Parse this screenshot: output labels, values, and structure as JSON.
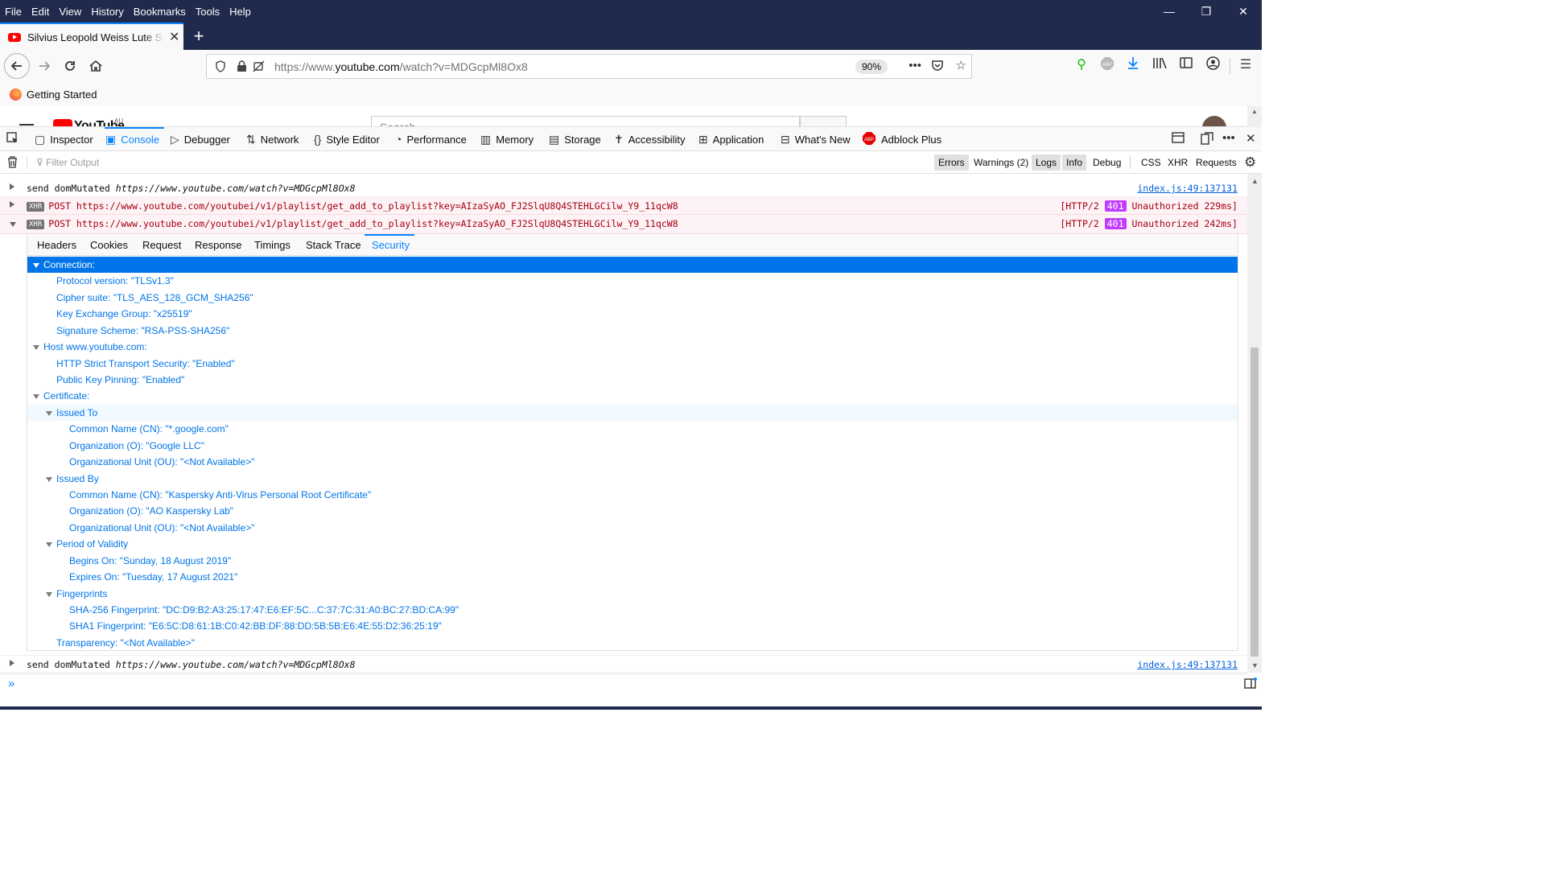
{
  "menu": [
    "File",
    "Edit",
    "View",
    "History",
    "Bookmarks",
    "Tools",
    "Help"
  ],
  "window_controls": {
    "minimize": "—",
    "restore": "❐",
    "close": "✕"
  },
  "tab": {
    "title": "Silvius Leopold Weiss Lute Son",
    "close": "✕"
  },
  "newtab_label": "+",
  "nav": {
    "url_prefix": "https://www.",
    "url_domain": "youtube.com",
    "url_rest": "/watch?v=MDGcpMl8Ox8",
    "zoom": "90%"
  },
  "bookmarks": {
    "item": "Getting Started"
  },
  "page": {
    "brand": "YouTube",
    "region": "AU",
    "search_placeholder": "Search"
  },
  "devtools": {
    "tabs": [
      "Inspector",
      "Console",
      "Debugger",
      "Network",
      "Style Editor",
      "Performance",
      "Memory",
      "Storage",
      "Accessibility",
      "Application",
      "What's New",
      "Adblock Plus"
    ],
    "filter_placeholder": "Filter Output",
    "filters": [
      "Errors",
      "Warnings (2)",
      "Logs",
      "Info",
      "Debug",
      "CSS",
      "XHR",
      "Requests"
    ]
  },
  "console": {
    "msg1": {
      "text_plain": "send domMutated ",
      "text_url": "https://www.youtube.com/watch?v=MDGcpMl8Ox8",
      "source": "index.js:49:137131"
    },
    "xhr1": {
      "badge": "XHR",
      "method": "POST",
      "url": "https://www.youtube.com/youtubei/v1/playlist/get_add_to_playlist?key=AIzaSyAO_FJ2SlqU8Q4STEHLGCilw_Y9_11qcW8",
      "status_pre": "[HTTP/2",
      "code": "401",
      "status_post": "Unauthorized 229ms]"
    },
    "xhr2": {
      "badge": "XHR",
      "method": "POST",
      "url": "https://www.youtube.com/youtubei/v1/playlist/get_add_to_playlist?key=AIzaSyAO_FJ2SlqU8Q4STEHLGCilw_Y9_11qcW8",
      "status_pre": "[HTTP/2",
      "code": "401",
      "status_post": "Unauthorized 242ms]"
    },
    "msg2": {
      "text_plain": "send domMutated ",
      "text_url": "https://www.youtube.com/watch?v=MDGcpMl8Ox8",
      "source": "index.js:49:137131"
    }
  },
  "detail_tabs": [
    "Headers",
    "Cookies",
    "Request",
    "Response",
    "Timings",
    "Stack Trace",
    "Security"
  ],
  "security": {
    "connection": "Connection:",
    "protocol": "Protocol version: \"TLSv1.3\"",
    "cipher": "Cipher suite: \"TLS_AES_128_GCM_SHA256\"",
    "kex": "Key Exchange Group: \"x25519\"",
    "sig": "Signature Scheme: \"RSA-PSS-SHA256\"",
    "host": "Host www.youtube.com:",
    "hsts": "HTTP Strict Transport Security: \"Enabled\"",
    "hpkp": "Public Key Pinning: \"Enabled\"",
    "certificate": "Certificate:",
    "issued_to": "Issued To",
    "to_cn": "Common Name (CN): \"*.google.com\"",
    "to_o": "Organization (O): \"Google LLC\"",
    "to_ou": "Organizational Unit (OU): \"<Not Available>\"",
    "issued_by": "Issued By",
    "by_cn": "Common Name (CN): \"Kaspersky Anti-Virus Personal Root Certificate\"",
    "by_o": "Organization (O): \"AO Kaspersky Lab\"",
    "by_ou": "Organizational Unit (OU): \"<Not Available>\"",
    "validity": "Period of Validity",
    "begins": "Begins On: \"Sunday, 18 August 2019\"",
    "expires": "Expires On: \"Tuesday, 17 August 2021\"",
    "fingerprints": "Fingerprints",
    "sha256": "SHA-256 Fingerprint: \"DC:D9:B2:A3:25:17:47:E6:EF:5C...C:37:7C:31:A0:BC:27:BD:CA:99\"",
    "sha1": "SHA1 Fingerprint: \"E6:5C:D8:61:1B:C0:42:BB:DF:88:DD:5B:5B:E6:4E:55:D2:36:25:19\"",
    "transparency": "Transparency: \"<Not Available>\""
  },
  "colors": {
    "accent": "#0a84ff",
    "chrome_dark": "#1f2a4d",
    "error_bg": "#fdf2f5",
    "status_401": "#c13cff",
    "link": "#0074e8"
  }
}
